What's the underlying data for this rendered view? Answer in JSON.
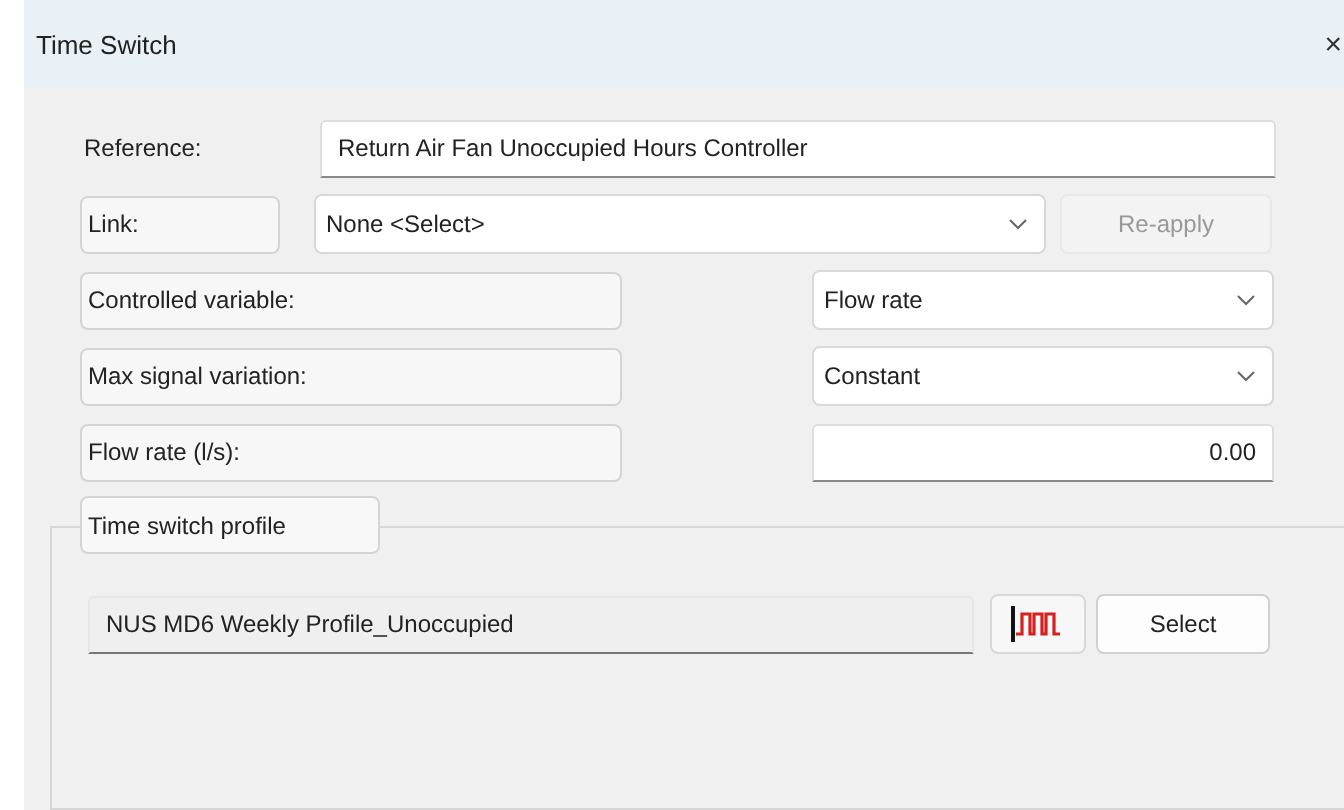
{
  "window": {
    "title": "Time Switch",
    "close": "×"
  },
  "reference": {
    "label": "Reference:",
    "value": "Return Air Fan Unoccupied Hours Controller"
  },
  "link": {
    "label": "Link:",
    "value": "None <Select>",
    "reapply": {
      "label": "Re-apply",
      "disabled": true
    }
  },
  "rows": [
    {
      "label": "Controlled variable:",
      "kind": "select",
      "value": "Flow rate"
    },
    {
      "label": "Max signal variation:",
      "kind": "select",
      "value": "Constant"
    },
    {
      "label": "Flow rate (l/s):",
      "kind": "number",
      "value": "0.00"
    }
  ],
  "profile": {
    "tab": "Time switch profile",
    "value": "NUS MD6 Weekly Profile_Unoccupied",
    "select_button": "Select"
  }
}
